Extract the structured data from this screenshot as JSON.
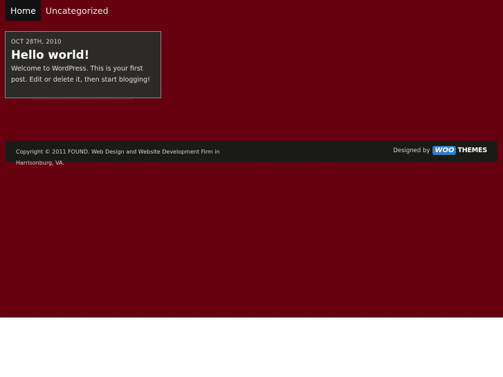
{
  "nav": {
    "items": [
      {
        "label": "Home",
        "active": true
      },
      {
        "label": "Uncategorized",
        "active": false
      }
    ]
  },
  "post": {
    "date": "OCT 28TH, 2010",
    "title": "Hello world!",
    "excerpt": "Welcome to WordPress. This is your first post. Edit or delete it, then start blogging!"
  },
  "footer": {
    "copyright": "Copyright © 2011 FOUND. Web Design and Website Development Firm in Harrisonburg, VA.",
    "designed_by": "Designed by",
    "logo_badge": "WOO",
    "logo_text": "THEMES"
  },
  "colors": {
    "background": "#690010",
    "nav_active": "#111111",
    "card": "#2c2b28",
    "footer": "#1a1b17",
    "woo_blue": "#2d7fc7"
  }
}
